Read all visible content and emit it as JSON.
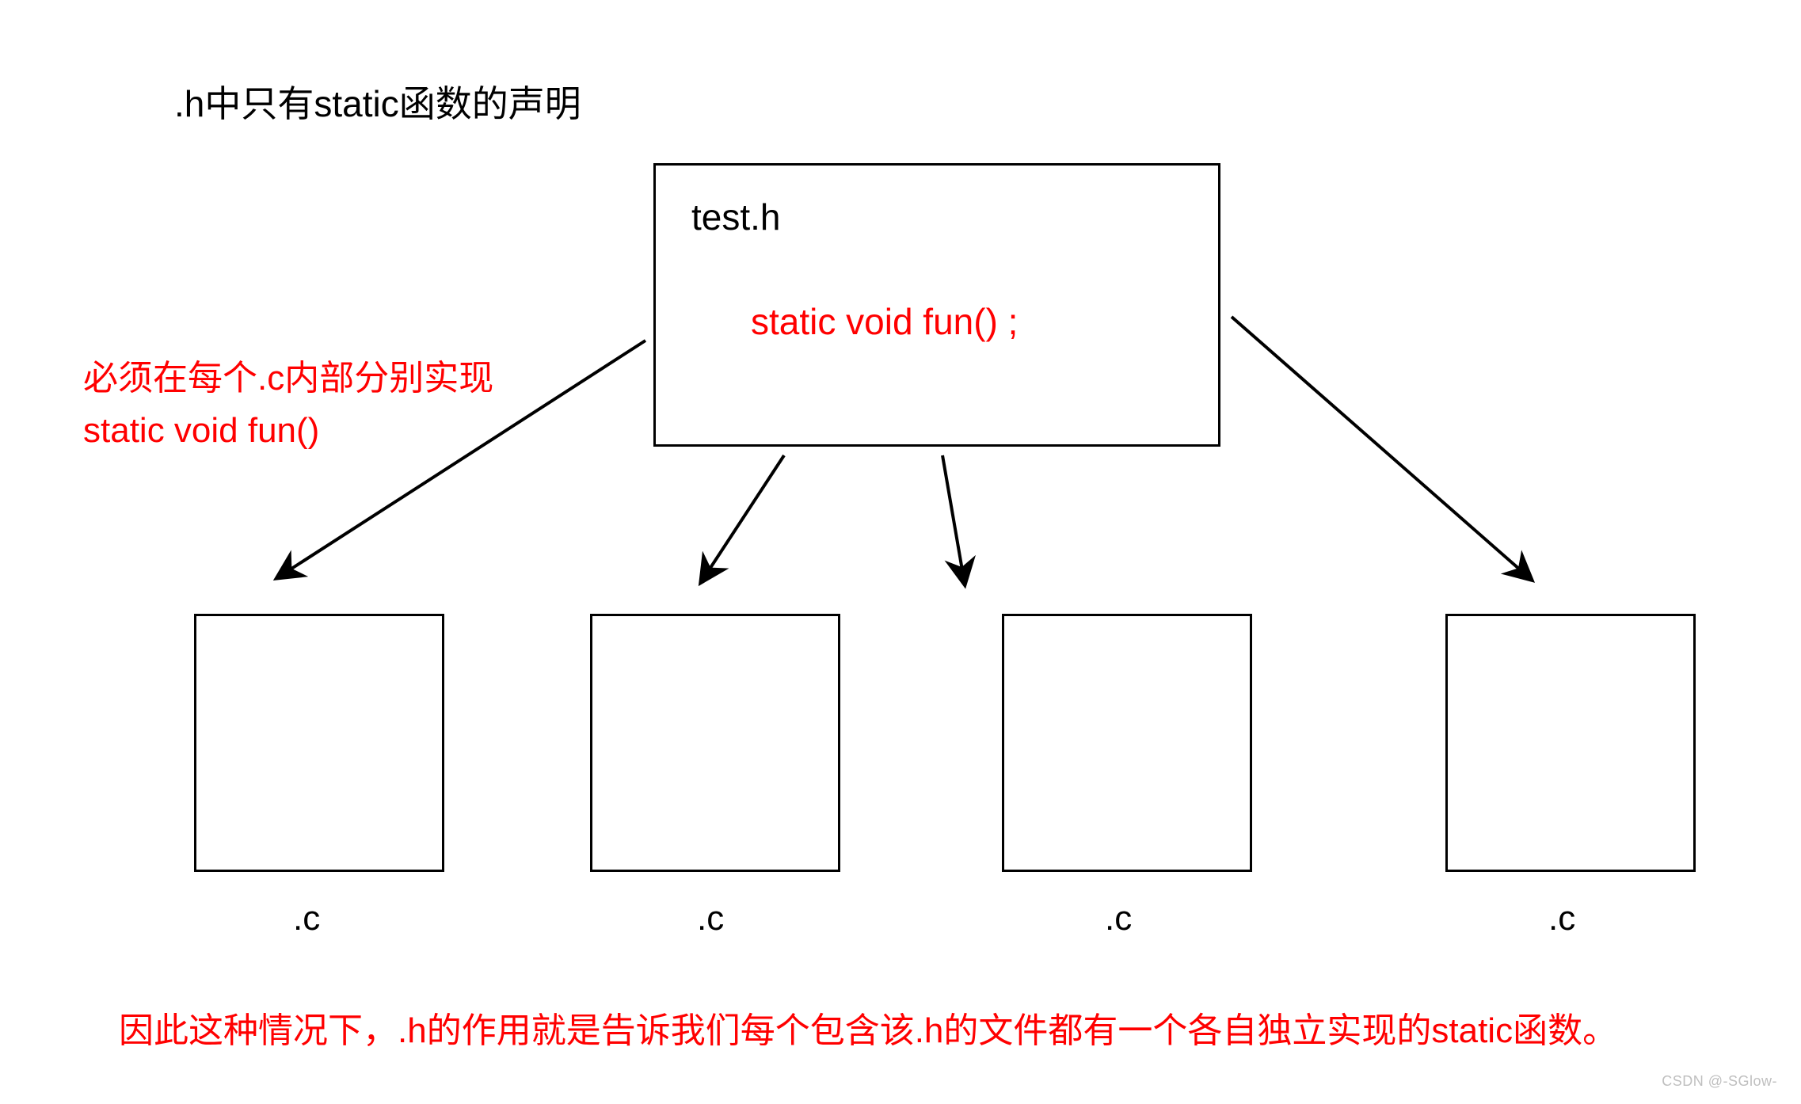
{
  "title": ".h中只有static函数的声明",
  "header_box": {
    "filename": "test.h",
    "code": "static void fun() ;"
  },
  "side_note": {
    "line1": "必须在每个.c内部分别实现",
    "line2": "static void fun()"
  },
  "c_labels": {
    "c1": ".c",
    "c2": ".c",
    "c3": ".c",
    "c4": ".c"
  },
  "bottom_note": "因此这种情况下，.h的作用就是告诉我们每个包含该.h的文件都有一个各自独立实现的static函数。",
  "watermark": "CSDN @-SGlow-"
}
